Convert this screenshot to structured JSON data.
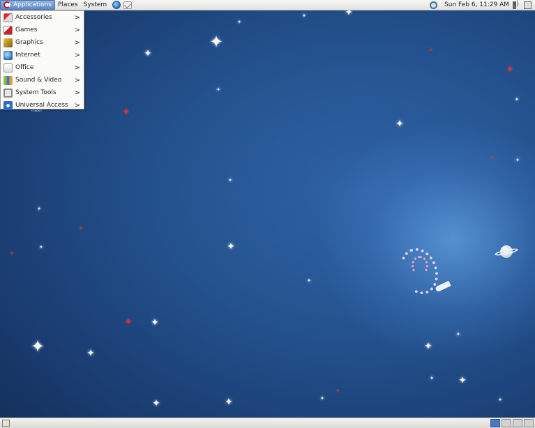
{
  "top_panel": {
    "applications_label": "Applications",
    "places_label": "Places",
    "system_label": "System",
    "clock": "Sun Feb  6, 11:29 AM"
  },
  "app_menu": {
    "items": [
      {
        "label": "Accessories",
        "icon": "accessories-icon"
      },
      {
        "label": "Games",
        "icon": "games-icon"
      },
      {
        "label": "Graphics",
        "icon": "graphics-icon"
      },
      {
        "label": "Internet",
        "icon": "internet-icon"
      },
      {
        "label": "Office",
        "icon": "office-icon"
      },
      {
        "label": "Sound & Video",
        "icon": "sound-video-icon"
      },
      {
        "label": "System Tools",
        "icon": "system-tools-icon"
      },
      {
        "label": "Universal Access",
        "icon": "universal-access-icon"
      }
    ],
    "submenu_arrow": ">"
  },
  "desktop": {
    "trash_label": "Trash"
  },
  "workspaces": {
    "count": 4,
    "active_index": 0
  },
  "colors": {
    "menu_highlight": "#5d89c6",
    "desktop_blue": "#24538f",
    "active_workspace": "#4a79c2"
  }
}
